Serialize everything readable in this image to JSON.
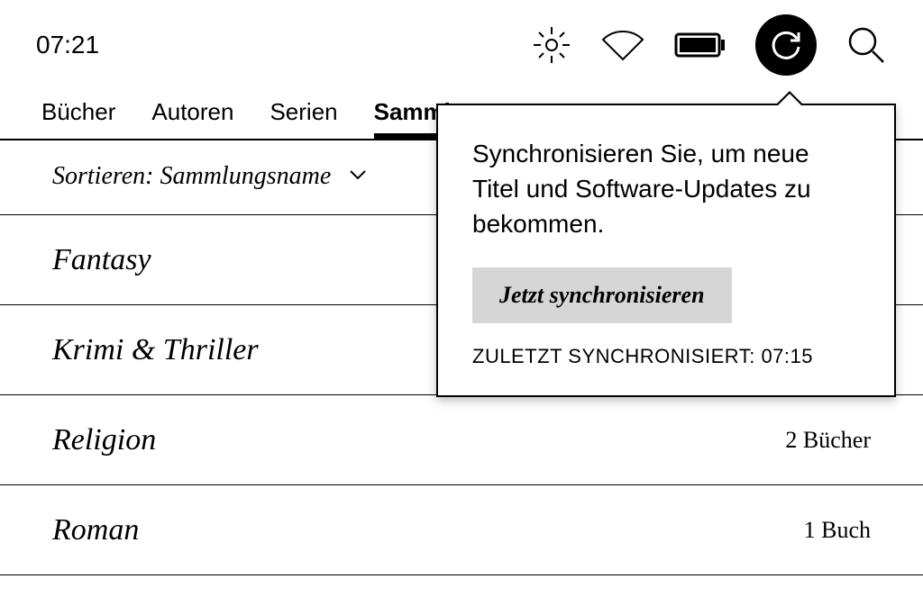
{
  "status": {
    "time": "07:21"
  },
  "tabs": [
    {
      "label": "Bücher",
      "selected": false
    },
    {
      "label": "Autoren",
      "selected": false
    },
    {
      "label": "Serien",
      "selected": false
    },
    {
      "label": "Sammlungen",
      "selected": true
    }
  ],
  "sort": {
    "label": "Sortieren: Sammlungsname"
  },
  "collections": [
    {
      "name": "Fantasy",
      "count": ""
    },
    {
      "name": "Krimi & Thriller",
      "count": ""
    },
    {
      "name": "Religion",
      "count": "2 Bücher"
    },
    {
      "name": "Roman",
      "count": "1 Buch"
    }
  ],
  "sync_popover": {
    "message": "Synchronisieren Sie, um neue Titel und Software-Updates zu bekommen.",
    "button": "Jetzt synchronisieren",
    "last": "ZULETZT SYNCHRONISIERT: 07:15"
  }
}
